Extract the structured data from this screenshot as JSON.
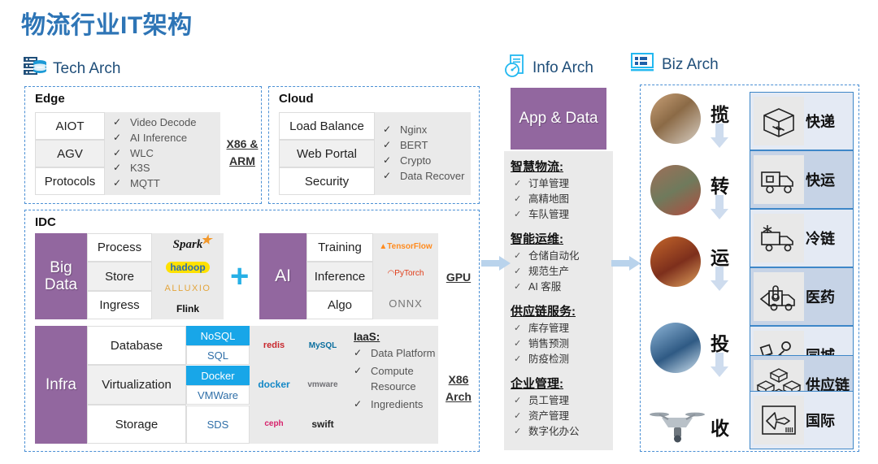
{
  "title": "物流行业IT架构",
  "columns": {
    "tech": {
      "label": "Tech Arch",
      "icon": "server-database-icon"
    },
    "info": {
      "label": "Info Arch",
      "icon": "document-gauge-icon"
    },
    "biz": {
      "label": "Biz Arch",
      "icon": "dashboard-monitor-icon"
    }
  },
  "edge": {
    "title": "Edge",
    "rows": [
      "AIOT",
      "AGV",
      "Protocols"
    ],
    "features": [
      "Video Decode",
      "AI Inference",
      "WLC",
      "K3S",
      "MQTT"
    ],
    "note": "X86 & ARM"
  },
  "cloud": {
    "title": "Cloud",
    "rows": [
      "Load Balance",
      "Web Portal",
      "Security"
    ],
    "features": [
      "Nginx",
      "BERT",
      "Crypto",
      "Data Recover"
    ]
  },
  "idc": {
    "title": "IDC",
    "bigdata": {
      "label": "Big Data",
      "rows": [
        "Process",
        "Store",
        "Ingress"
      ],
      "logos": [
        "Spark",
        "hadoop",
        "ALLUXIO",
        "Flink"
      ]
    },
    "plus": "+",
    "ai": {
      "label": "AI",
      "rows": [
        "Training",
        "Inference",
        "Algo"
      ],
      "logos": [
        "TensorFlow",
        "PyTorch",
        "ONNX"
      ],
      "note": "GPU"
    },
    "infra": {
      "label": "Infra",
      "rows": [
        "Database",
        "Virtualization",
        "Storage"
      ],
      "subcells": [
        {
          "text": "NoSQL",
          "active": true
        },
        {
          "text": "SQL",
          "active": false
        },
        {
          "text": "Docker",
          "active": true
        },
        {
          "text": "VMWare",
          "active": false
        },
        {
          "text": "SDS",
          "active": false
        }
      ],
      "logos": [
        "redis",
        "MySQL",
        "docker",
        "vmware",
        "ceph",
        "swift"
      ],
      "iaas_title": "IaaS:",
      "iaas": [
        "Data Platform",
        "Compute Resource",
        "Ingredients"
      ],
      "note": "X86 Arch"
    }
  },
  "info": {
    "head": "App & Data",
    "groups": [
      {
        "title": "智慧物流:",
        "items": [
          "订单管理",
          "高精地图",
          "车队管理"
        ]
      },
      {
        "title": "智能运维:",
        "items": [
          "仓储自动化",
          "规范生产",
          "AI 客服"
        ]
      },
      {
        "title": "供应链服务:",
        "items": [
          "库存管理",
          "销售预测",
          "防疫检测"
        ]
      },
      {
        "title": "企业管理:",
        "items": [
          "员工管理",
          "资产管理",
          "数字化办公"
        ]
      }
    ]
  },
  "biz": {
    "stages": [
      "揽",
      "转",
      "运",
      "投",
      "收"
    ],
    "photos": [
      "scanning-parcel-photo",
      "sorting-center-photo",
      "conveyor-belt-photo",
      "truck-fleet-photo",
      "drone-photo"
    ],
    "cards": [
      {
        "label": "快递",
        "icon": "parcel-box-icon",
        "shade": false
      },
      {
        "label": "快运",
        "icon": "freight-truck-icon",
        "shade": true
      },
      {
        "label": "冷链",
        "icon": "refrigerated-truck-icon",
        "shade": false
      },
      {
        "label": "医药",
        "icon": "medical-truck-icon",
        "shade": true
      },
      {
        "label": "同城",
        "icon": "courier-runner-icon",
        "shade": false
      },
      {
        "label": "供应链",
        "icon": "supply-chain-boxes-icon",
        "shade": true
      },
      {
        "label": "国际",
        "icon": "air-freight-icon",
        "shade": false
      }
    ]
  },
  "colors": {
    "title": "#2E75B6",
    "purple": "#92679F",
    "accent_blue": "#18A6E8",
    "dashed_border": "#4A8FD4",
    "panel_grey": "#EAEAEA"
  }
}
